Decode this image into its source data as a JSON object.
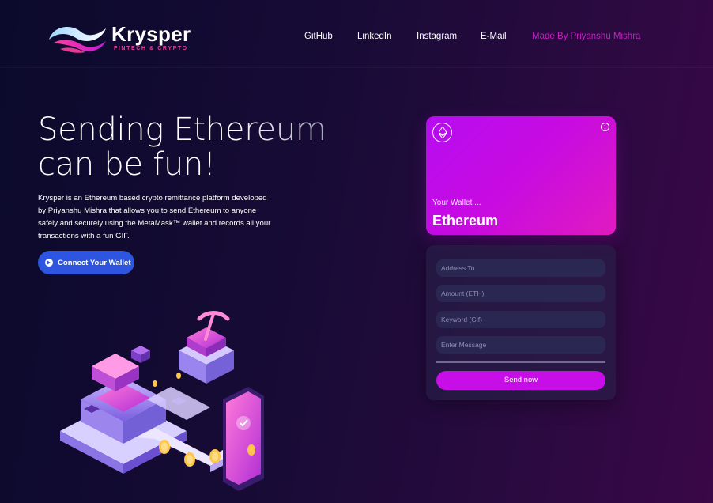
{
  "brand": {
    "name": "Krysper",
    "tagline": "FINTECH & CRYPTO"
  },
  "nav": {
    "links": [
      "GitHub",
      "LinkedIn",
      "Instagram",
      "E-Mail"
    ],
    "credit": "Made By Priyanshu Mishra"
  },
  "hero": {
    "title": "Sending Ethereum can be fun!",
    "description": "Krysper is an Ethereum based crypto remittance platform developed by Priyanshu Mishra that allows you to send Ethereum to anyone safely and securely using the MetaMask™ wallet and records all your transactions with a fun GIF.",
    "connect_label": "Connect Your Wallet"
  },
  "card": {
    "wallet_label": "Your Wallet ...",
    "wallet_name": "Ethereum"
  },
  "form": {
    "address_placeholder": "Address To",
    "amount_placeholder": "Amount (ETH)",
    "keyword_placeholder": "Keyword (Gif)",
    "message_placeholder": "Enter Message",
    "send_label": "Send now"
  },
  "colors": {
    "accent": "#c70ee6",
    "connect_button": "#2d55e0",
    "nav_credit": "#c91fc5",
    "logo_tagline": "#e83a9a"
  },
  "icons": {
    "connect": "arrow-circle-icon",
    "card_logo": "ethereum-icon",
    "card_info": "info-icon"
  }
}
